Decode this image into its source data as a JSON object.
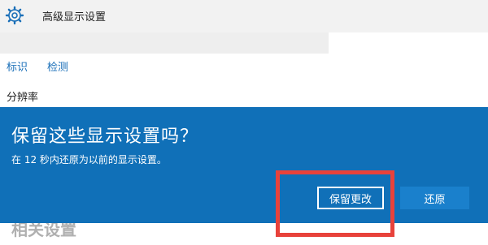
{
  "window": {
    "title": "高级显示设置",
    "icon": "gear-icon"
  },
  "nav": {
    "identify_label": "标识",
    "detect_label": "检测"
  },
  "settings": {
    "resolution_label": "分辨率",
    "faded_heading": "相关设置"
  },
  "dialog": {
    "title": "保留这些显示设置吗？",
    "message": "在 12 秒内还原为以前的显示设置。",
    "keep_label": "保留更改",
    "revert_label": "还原",
    "accent_color": "#1070b8"
  },
  "annotation": {
    "highlight_color": "#e8423b"
  }
}
